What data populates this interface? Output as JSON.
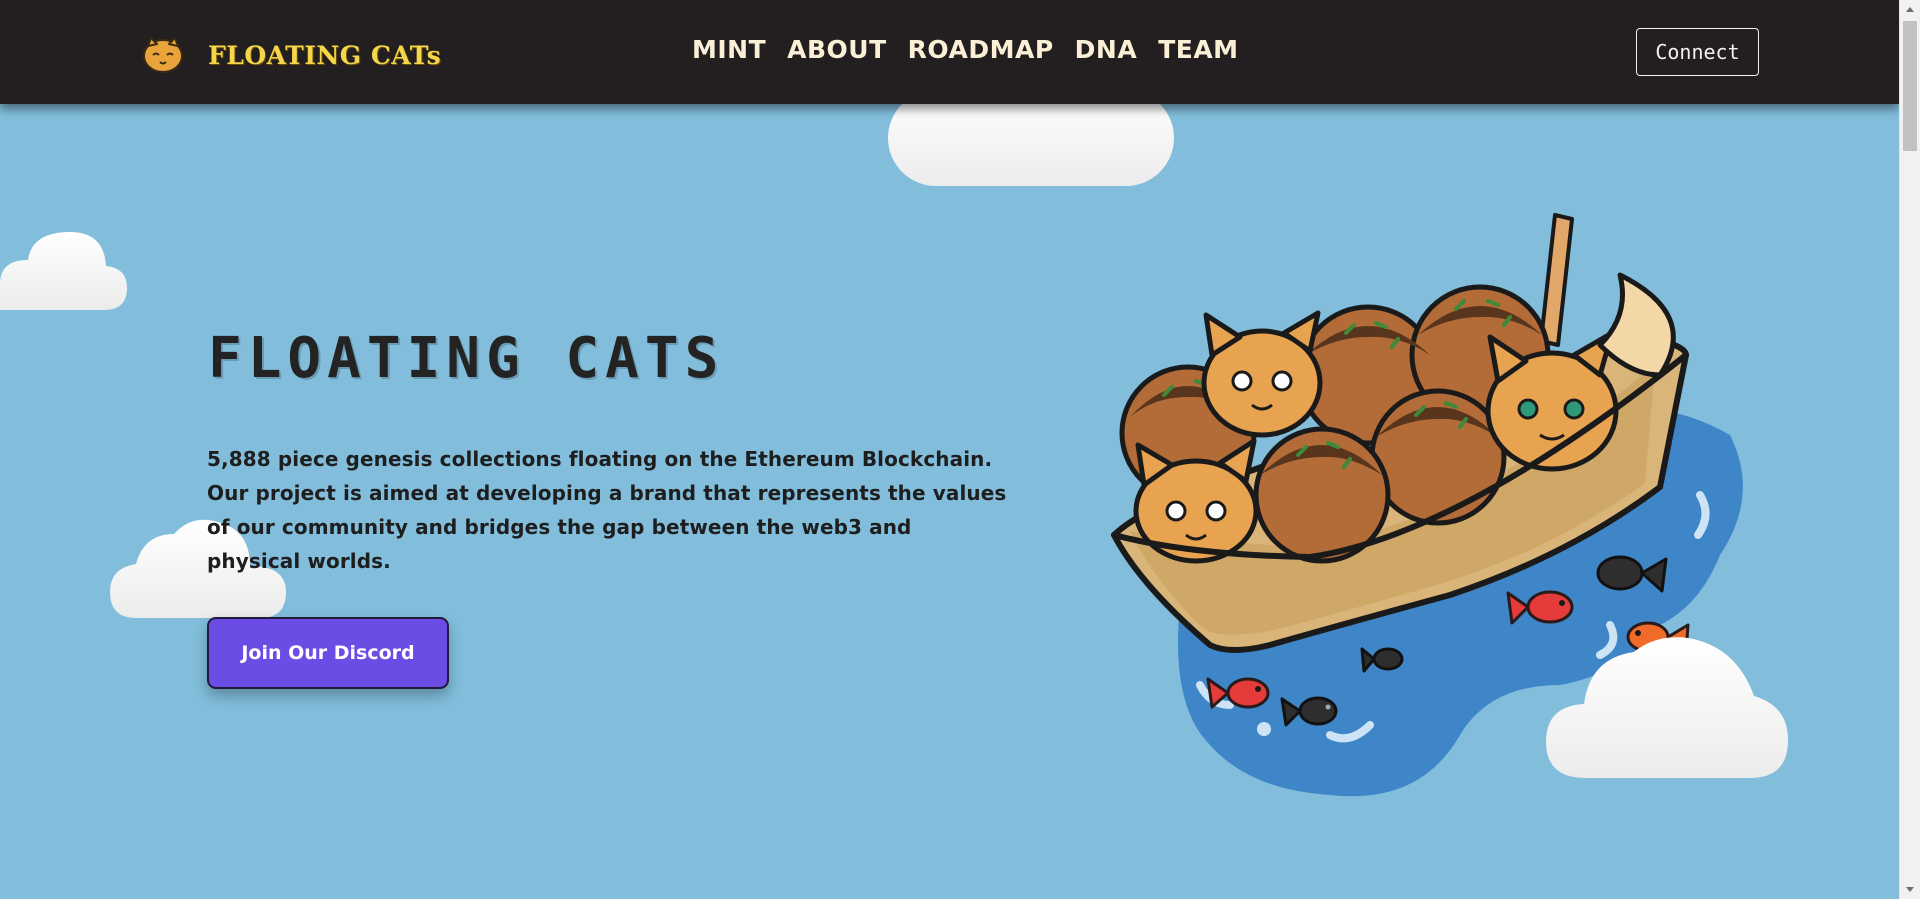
{
  "nav": {
    "brand_name": "FLOATING CATs",
    "brand_logo_icon": "cat-face-logo-icon",
    "links": [
      "MINT",
      "ABOUT",
      "ROADMAP",
      "DNA",
      "TEAM"
    ],
    "connect_label": "Connect"
  },
  "hero": {
    "title": "FLOATING CATS",
    "description": "5,888 piece genesis collections floating on the Ethereum Blockchain. Our project is aimed at developing a brand that represents the values of our community and bridges the gap between the web3 and physical worlds.",
    "discord_label": "Join Our Discord",
    "illustration_icon": "cats-in-takoyaki-boat-icon"
  },
  "colors": {
    "navbar_bg": "#231f20",
    "brand_yellow": "#f5d64a",
    "nav_text": "#fbefd6",
    "sky_bg": "#82bedc",
    "discord_purple": "#6b4de6"
  }
}
